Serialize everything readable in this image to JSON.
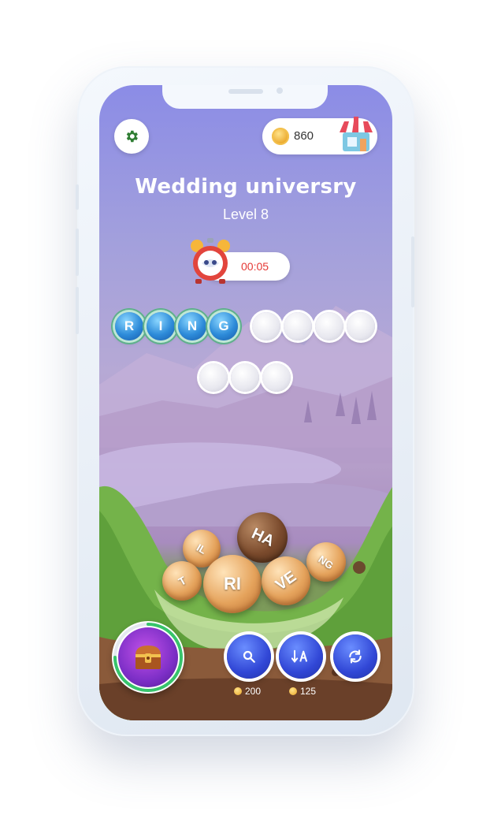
{
  "header": {
    "coins": "860",
    "settings_icon": "gear-icon",
    "shop_icon": "shop-icon"
  },
  "puzzle": {
    "title": "Wedding universry",
    "level": "Level 8",
    "timer": "00:05"
  },
  "word_rows": [
    {
      "filled": [
        "R",
        "I",
        "N",
        "G"
      ],
      "empty_count": 4
    },
    {
      "filled": [],
      "empty_count": 3
    }
  ],
  "letter_balls": [
    {
      "label": "HA"
    },
    {
      "label": "IL"
    },
    {
      "label": "NG"
    },
    {
      "label": "T"
    },
    {
      "label": "RI"
    },
    {
      "label": "VE"
    }
  ],
  "powerups": [
    {
      "name": "search",
      "icon": "search-icon",
      "cost": "200"
    },
    {
      "name": "sort",
      "icon": "sort-icon",
      "cost": "125"
    },
    {
      "name": "shuffle",
      "icon": "shuffle-icon",
      "cost": ""
    }
  ],
  "colors": {
    "accent_blue": "#3147d6",
    "timer_red": "#e53935",
    "tile_blue": "#2d8bd9"
  }
}
